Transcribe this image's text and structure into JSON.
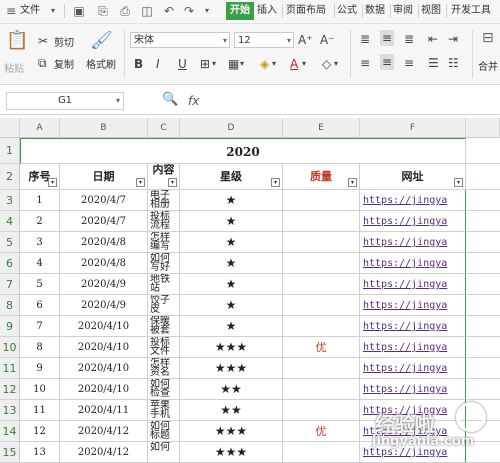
{
  "menubar": {
    "file_menu": "文件",
    "tabs": [
      "开始",
      "插入",
      "页面布局",
      "公式",
      "数据",
      "审阅",
      "视图",
      "开发工具"
    ]
  },
  "ribbon": {
    "paste": "粘贴",
    "cut": "剪切",
    "copy": "复制",
    "format_painter": "格式刷",
    "font_name": "宋体",
    "font_size": "12",
    "bold": "B",
    "italic": "I",
    "underline": "U",
    "merge_center": "合并"
  },
  "formula_bar": {
    "name_box": "G1",
    "fx_label": "fx",
    "content": ""
  },
  "sheet": {
    "columns": [
      "A",
      "B",
      "C",
      "D",
      "E",
      "F"
    ],
    "title": "2020",
    "headers": [
      "序号",
      "日期",
      "内容",
      "星级",
      "质量",
      "网址"
    ],
    "row_numbers": [
      "1",
      "2",
      "3",
      "4",
      "5",
      "6",
      "7",
      "8",
      "9",
      "10",
      "11",
      "12",
      "13",
      "14",
      "15"
    ],
    "rows": [
      {
        "num": "1",
        "date": "2020/4/7",
        "content": "电子相册",
        "stars": "★",
        "quality": "",
        "url": "https://jingya"
      },
      {
        "num": "2",
        "date": "2020/4/7",
        "content": "投标流程",
        "stars": "★",
        "quality": "",
        "url": "https://jingya"
      },
      {
        "num": "3",
        "date": "2020/4/8",
        "content": "怎样编写",
        "stars": "★",
        "quality": "",
        "url": "https://jingya"
      },
      {
        "num": "4",
        "date": "2020/4/8",
        "content": "如何写好",
        "stars": "★",
        "quality": "",
        "url": "https://jingya"
      },
      {
        "num": "5",
        "date": "2020/4/9",
        "content": "地铁站",
        "stars": "★",
        "quality": "",
        "url": "https://jingya"
      },
      {
        "num": "6",
        "date": "2020/4/9",
        "content": "饺子皮",
        "stars": "★",
        "quality": "",
        "url": "https://jingya"
      },
      {
        "num": "7",
        "date": "2020/4/10",
        "content": "保暖被套",
        "stars": "★",
        "quality": "",
        "url": "https://jingya"
      },
      {
        "num": "8",
        "date": "2020/4/10",
        "content": "投标文件",
        "stars": "★★★",
        "quality": "优",
        "url": "https://jingya"
      },
      {
        "num": "9",
        "date": "2020/4/10",
        "content": "怎样资名",
        "stars": "★★★",
        "quality": "",
        "url": "https://jingya"
      },
      {
        "num": "10",
        "date": "2020/4/10",
        "content": "如何检查",
        "stars": "★★",
        "quality": "",
        "url": "https://jingya"
      },
      {
        "num": "11",
        "date": "2020/4/11",
        "content": "苹果手机",
        "stars": "★★",
        "quality": "",
        "url": "https://jingya"
      },
      {
        "num": "12",
        "date": "2020/4/12",
        "content": "如何标题",
        "stars": "★★★",
        "quality": "优",
        "url": "https://jingya"
      },
      {
        "num": "13",
        "date": "2020/4/12",
        "content": "如何",
        "stars": "★★★",
        "quality": "",
        "url": "https://jingya"
      }
    ]
  },
  "watermark": {
    "line1": "经验啦",
    "line2": "jingyanla.com",
    "check": "✓"
  },
  "colors": {
    "active_tab": "#3a9f45",
    "quality_text": "#c0392b",
    "url_text": "#5a2b86",
    "border_green": "#3a9f45"
  }
}
